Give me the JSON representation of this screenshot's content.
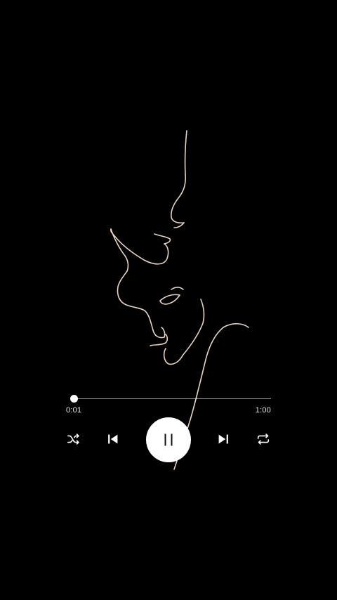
{
  "artwork": {
    "icon": "line-art-couple-illustration",
    "stroke_color": "#e8d3c4",
    "background_color": "#000000"
  },
  "player": {
    "elapsed_time": "0:01",
    "total_time": "1:00",
    "progress_fraction": 0.017,
    "state": "playing",
    "controls": {
      "shuffle_icon": "shuffle-icon",
      "previous_icon": "skip-previous-icon",
      "pause_icon": "pause-icon",
      "next_icon": "skip-next-icon",
      "repeat_icon": "repeat-icon"
    }
  }
}
